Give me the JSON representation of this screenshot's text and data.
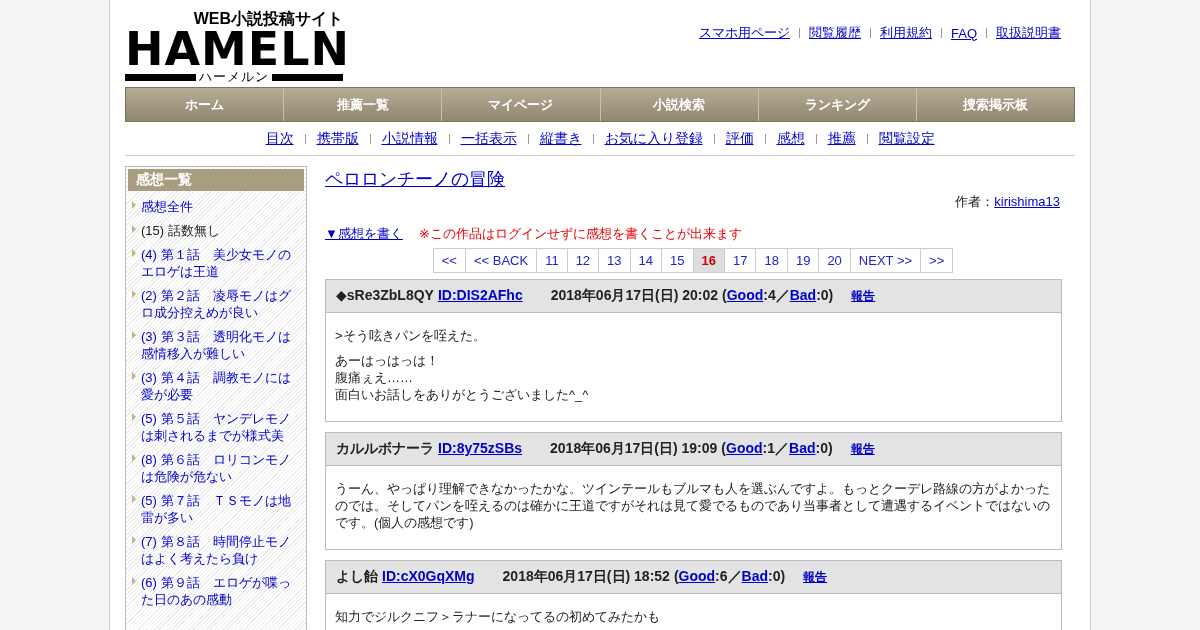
{
  "logo": {
    "tagline": "WEB小説投稿サイト",
    "wordmark": "HAMELN",
    "kana": "ハーメルン"
  },
  "top_links": [
    "スマホ用ページ",
    "閲覧履歴",
    "利用規約",
    "FAQ",
    "取扱説明書"
  ],
  "nav": [
    "ホーム",
    "推薦一覧",
    "マイページ",
    "小説検索",
    "ランキング",
    "捜索掲示板"
  ],
  "sub_links": [
    "目次",
    "携帯版",
    "小説情報",
    "一括表示",
    "縦書き",
    "お気に入り登録",
    "評価",
    "感想",
    "推薦",
    "閲覧設定"
  ],
  "sidebar": {
    "title": "感想一覧",
    "items": [
      {
        "text": "感想全件",
        "linked": true
      },
      {
        "text": "(15) 話数無し",
        "linked": false
      },
      {
        "text": "(4) 第１話　美少女モノのエロゲは王道",
        "linked": true
      },
      {
        "text": "(2) 第２話　凌辱モノはグロ成分控えめが良い",
        "linked": true
      },
      {
        "text": "(3) 第３話　透明化モノは感情移入が難しい",
        "linked": true
      },
      {
        "text": "(3) 第４話　調教モノには愛が必要",
        "linked": true
      },
      {
        "text": "(5) 第５話　ヤンデレモノは刺されるまでが様式美",
        "linked": true
      },
      {
        "text": "(8) 第６話　ロリコンモノは危険が危ない",
        "linked": true
      },
      {
        "text": "(5) 第７話　ＴＳモノは地雷が多い",
        "linked": true
      },
      {
        "text": "(7) 第８話　時間停止モノはよく考えたら負け",
        "linked": true
      },
      {
        "text": "(6) 第９話　エロゲが喋った日のあの感動",
        "linked": true
      }
    ]
  },
  "novel": {
    "title": "ペロロンチーノの冒険",
    "author_label": "作者：",
    "author": "kirishima13"
  },
  "write_link": "▼感想を書く",
  "notice": "※この作品はログインせずに感想を書くことが出来ます",
  "pager": [
    {
      "label": "<<",
      "selected": false
    },
    {
      "label": "<< BACK",
      "selected": false
    },
    {
      "label": "11",
      "selected": false
    },
    {
      "label": "12",
      "selected": false
    },
    {
      "label": "13",
      "selected": false
    },
    {
      "label": "14",
      "selected": false
    },
    {
      "label": "15",
      "selected": false
    },
    {
      "label": "16",
      "selected": true
    },
    {
      "label": "17",
      "selected": false
    },
    {
      "label": "18",
      "selected": false
    },
    {
      "label": "19",
      "selected": false
    },
    {
      "label": "20",
      "selected": false
    },
    {
      "label": "NEXT >>",
      "selected": false
    },
    {
      "label": ">>",
      "selected": false
    }
  ],
  "comments": [
    {
      "name": "◆sRe3ZbL8QY",
      "id": "ID:DIS2AFhc",
      "date": "2018年06月17日(日) 20:02",
      "vote_open": "(",
      "good_label": "Good",
      "good": ":4／",
      "bad_label": "Bad",
      "bad": ":0)",
      "report": "報告",
      "paragraphs": [
        [
          ">そう呟きパンを咥えた。"
        ],
        [
          "あーはっはっは！",
          "腹痛ぇえ……",
          "面白いお話しをありがとうございました^_^"
        ]
      ]
    },
    {
      "name": "カルルボナーラ",
      "id": "ID:8y75zSBs",
      "date": "2018年06月17日(日) 19:09",
      "vote_open": "(",
      "good_label": "Good",
      "good": ":1／",
      "bad_label": "Bad",
      "bad": ":0)",
      "report": "報告",
      "paragraphs": [
        [
          "うーん、やっぱり理解できなかったかな。ツインテールもブルマも人を選ぶんですよ。もっとクーデレ路線の方がよかったのでは。そしてパンを咥えるのは確かに王道ですがそれは見て愛でるものであり当事者として遭遇するイベントではないのです。(個人の感想です)"
        ]
      ]
    },
    {
      "name": "よし飴",
      "id": "ID:cX0GqXMg",
      "date": "2018年06月17日(日) 18:52",
      "vote_open": "(",
      "good_label": "Good",
      "good": ":6／",
      "bad_label": "Bad",
      "bad": ":0)",
      "report": "報告",
      "paragraphs": [
        [
          "知力でジルクニフ＞ラナーになってるの初めてみたかも"
        ]
      ]
    }
  ]
}
